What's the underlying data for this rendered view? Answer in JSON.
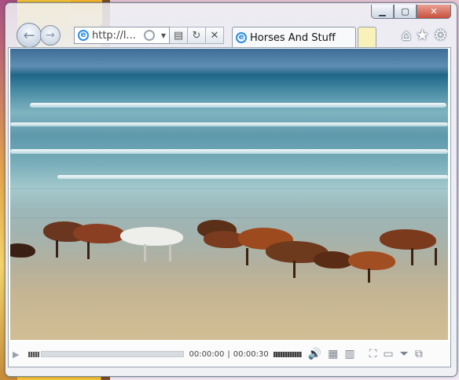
{
  "window": {
    "buttons": {
      "minimize": "▁",
      "maximize": "▢",
      "close": "✕"
    }
  },
  "navigation": {
    "back_icon": "back-arrow-icon",
    "forward_icon": "forward-arrow-icon",
    "address_value": "http://l...",
    "address_icons": [
      "ie-icon",
      "search-icon",
      "dropdown-icon",
      "compatibility-icon",
      "refresh-icon",
      "stop-icon"
    ]
  },
  "tab": {
    "title": "Horses And Stuff",
    "icon": "ie-icon"
  },
  "toolbar": {
    "icons": [
      "home-icon",
      "favorites-star-icon",
      "settings-gear-icon"
    ]
  },
  "player": {
    "current_time": "00:00:00",
    "divider": "|",
    "total_time": "00:00:30",
    "icons": [
      "play-icon",
      "volume-icon",
      "playlist-icon",
      "library-icon",
      "fullscreen-icon",
      "compact-icon",
      "menu-icon",
      "switch-view-icon"
    ]
  },
  "colors": {
    "accent_ie": "#2d8ee0",
    "close_button": "#c7513d",
    "new_tab": "#f8f1b9"
  }
}
